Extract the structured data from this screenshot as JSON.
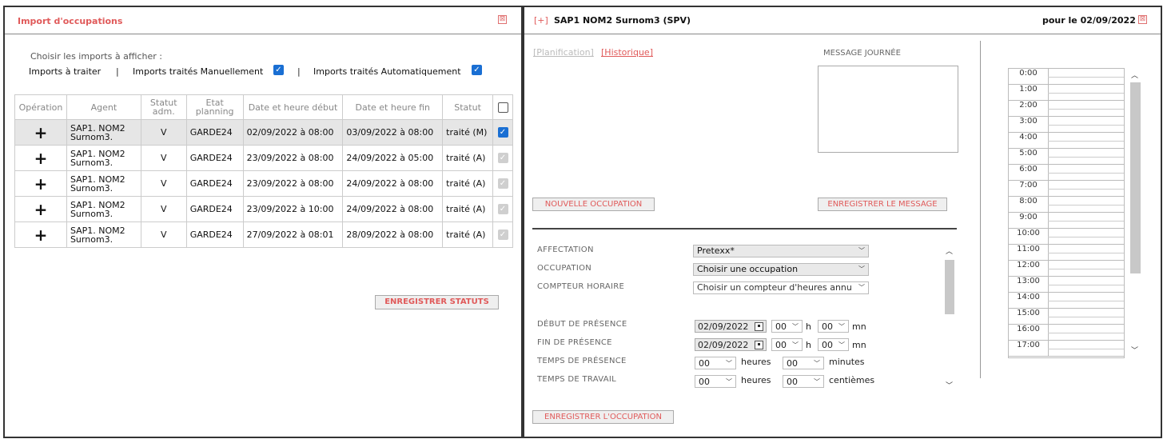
{
  "left_panel": {
    "title": "Import d'occupations",
    "close_symbol": "⊠",
    "choose_label": "Choisir les imports à afficher :",
    "filter_to_process": "Imports à traiter",
    "sep1": "|",
    "filter_manual": "Imports traités Manuellement",
    "filter_manual_checked": true,
    "sep2": "|",
    "filter_auto": "Imports traités Automatiquement",
    "filter_auto_checked": true,
    "table": {
      "headers": [
        "Opération",
        "Agent",
        "Statut adm.",
        "Etat planning",
        "Date et heure début",
        "Date et heure fin",
        "Statut"
      ],
      "header_statut_adm_1": "Statut",
      "header_statut_adm_2": "adm.",
      "header_etat_1": "Etat",
      "header_etat_2": "planning",
      "rows": [
        {
          "op": "+",
          "agent1": "SAP1. NOM2",
          "agent2": "Surnom3.",
          "statut_adm": "V",
          "etat": "GARDE24",
          "debut": "02/09/2022 à 08:00",
          "fin": "03/09/2022 à 08:00",
          "statut": "traité (M)",
          "check": "on"
        },
        {
          "op": "+",
          "agent1": "SAP1. NOM2",
          "agent2": "Surnom3.",
          "statut_adm": "V",
          "etat": "GARDE24",
          "debut": "23/09/2022 à 08:00",
          "fin": "24/09/2022 à 05:00",
          "statut": "traité (A)",
          "check": "dis"
        },
        {
          "op": "+",
          "agent1": "SAP1. NOM2",
          "agent2": "Surnom3.",
          "statut_adm": "V",
          "etat": "GARDE24",
          "debut": "23/09/2022 à 08:00",
          "fin": "24/09/2022 à 08:00",
          "statut": "traité (A)",
          "check": "dis"
        },
        {
          "op": "+",
          "agent1": "SAP1. NOM2",
          "agent2": "Surnom3.",
          "statut_adm": "V",
          "etat": "GARDE24",
          "debut": "23/09/2022 à 10:00",
          "fin": "24/09/2022 à 08:00",
          "statut": "traité (A)",
          "check": "dis"
        },
        {
          "op": "+",
          "agent1": "SAP1. NOM2",
          "agent2": "Surnom3.",
          "statut_adm": "V",
          "etat": "GARDE24",
          "debut": "27/09/2022 à 08:01",
          "fin": "28/09/2022 à 08:00",
          "statut": "traité (A)",
          "check": "dis"
        }
      ]
    },
    "save_status_button": "ENREGISTRER STATUTS"
  },
  "right_panel": {
    "expand": "[+]",
    "agent_title": "SAP1 NOM2 Surnom3 (SPV)",
    "date_label": "pour le 02/09/2022",
    "close_symbol": "⊠",
    "link_planification": "[Planification]",
    "link_historique": "[Historique]",
    "message_label": "MESSAGE JOURNÉE",
    "new_occupation_button": "NOUVELLE OCCUPATION",
    "save_message_button": "ENREGISTRER LE MESSAGE",
    "form": {
      "affectation_label": "AFFECTATION",
      "affectation_value": "Pretexx*",
      "occupation_label": "OCCUPATION",
      "occupation_value": "Choisir une occupation",
      "compteur_label": "COMPTEUR HORAIRE",
      "compteur_value": "Choisir un compteur d'heures annu",
      "debut_label": "DÉBUT DE PRÉSENCE",
      "debut_date": "02/09/2022",
      "debut_h": "00",
      "debut_mn": "00",
      "fin_label": "FIN DE PRÉSENCE",
      "fin_date": "02/09/2022",
      "fin_h": "00",
      "fin_mn": "00",
      "h_unit": "h",
      "mn_unit": "mn",
      "temps_presence_label": "TEMPS DE PRÉSENCE",
      "tp_heures": "00",
      "tp_heures_unit": "heures",
      "tp_minutes": "00",
      "tp_minutes_unit": "minutes",
      "temps_travail_label": "TEMPS DE TRAVAIL",
      "tt_heures": "00",
      "tt_heures_unit": "heures",
      "tt_centiemes": "00",
      "tt_centiemes_unit": "centièmes"
    },
    "save_occupation_button": "ENREGISTRER L'OCCUPATION",
    "hours": [
      "0:00",
      "1:00",
      "2:00",
      "3:00",
      "4:00",
      "5:00",
      "6:00",
      "7:00",
      "8:00",
      "9:00",
      "10:00",
      "11:00",
      "12:00",
      "13:00",
      "14:00",
      "15:00",
      "16:00",
      "17:00"
    ]
  },
  "colors": {
    "title_red": "#e05a5a",
    "checkbox_blue": "#1a6fd3",
    "plus_blue": "#1e9be0"
  }
}
